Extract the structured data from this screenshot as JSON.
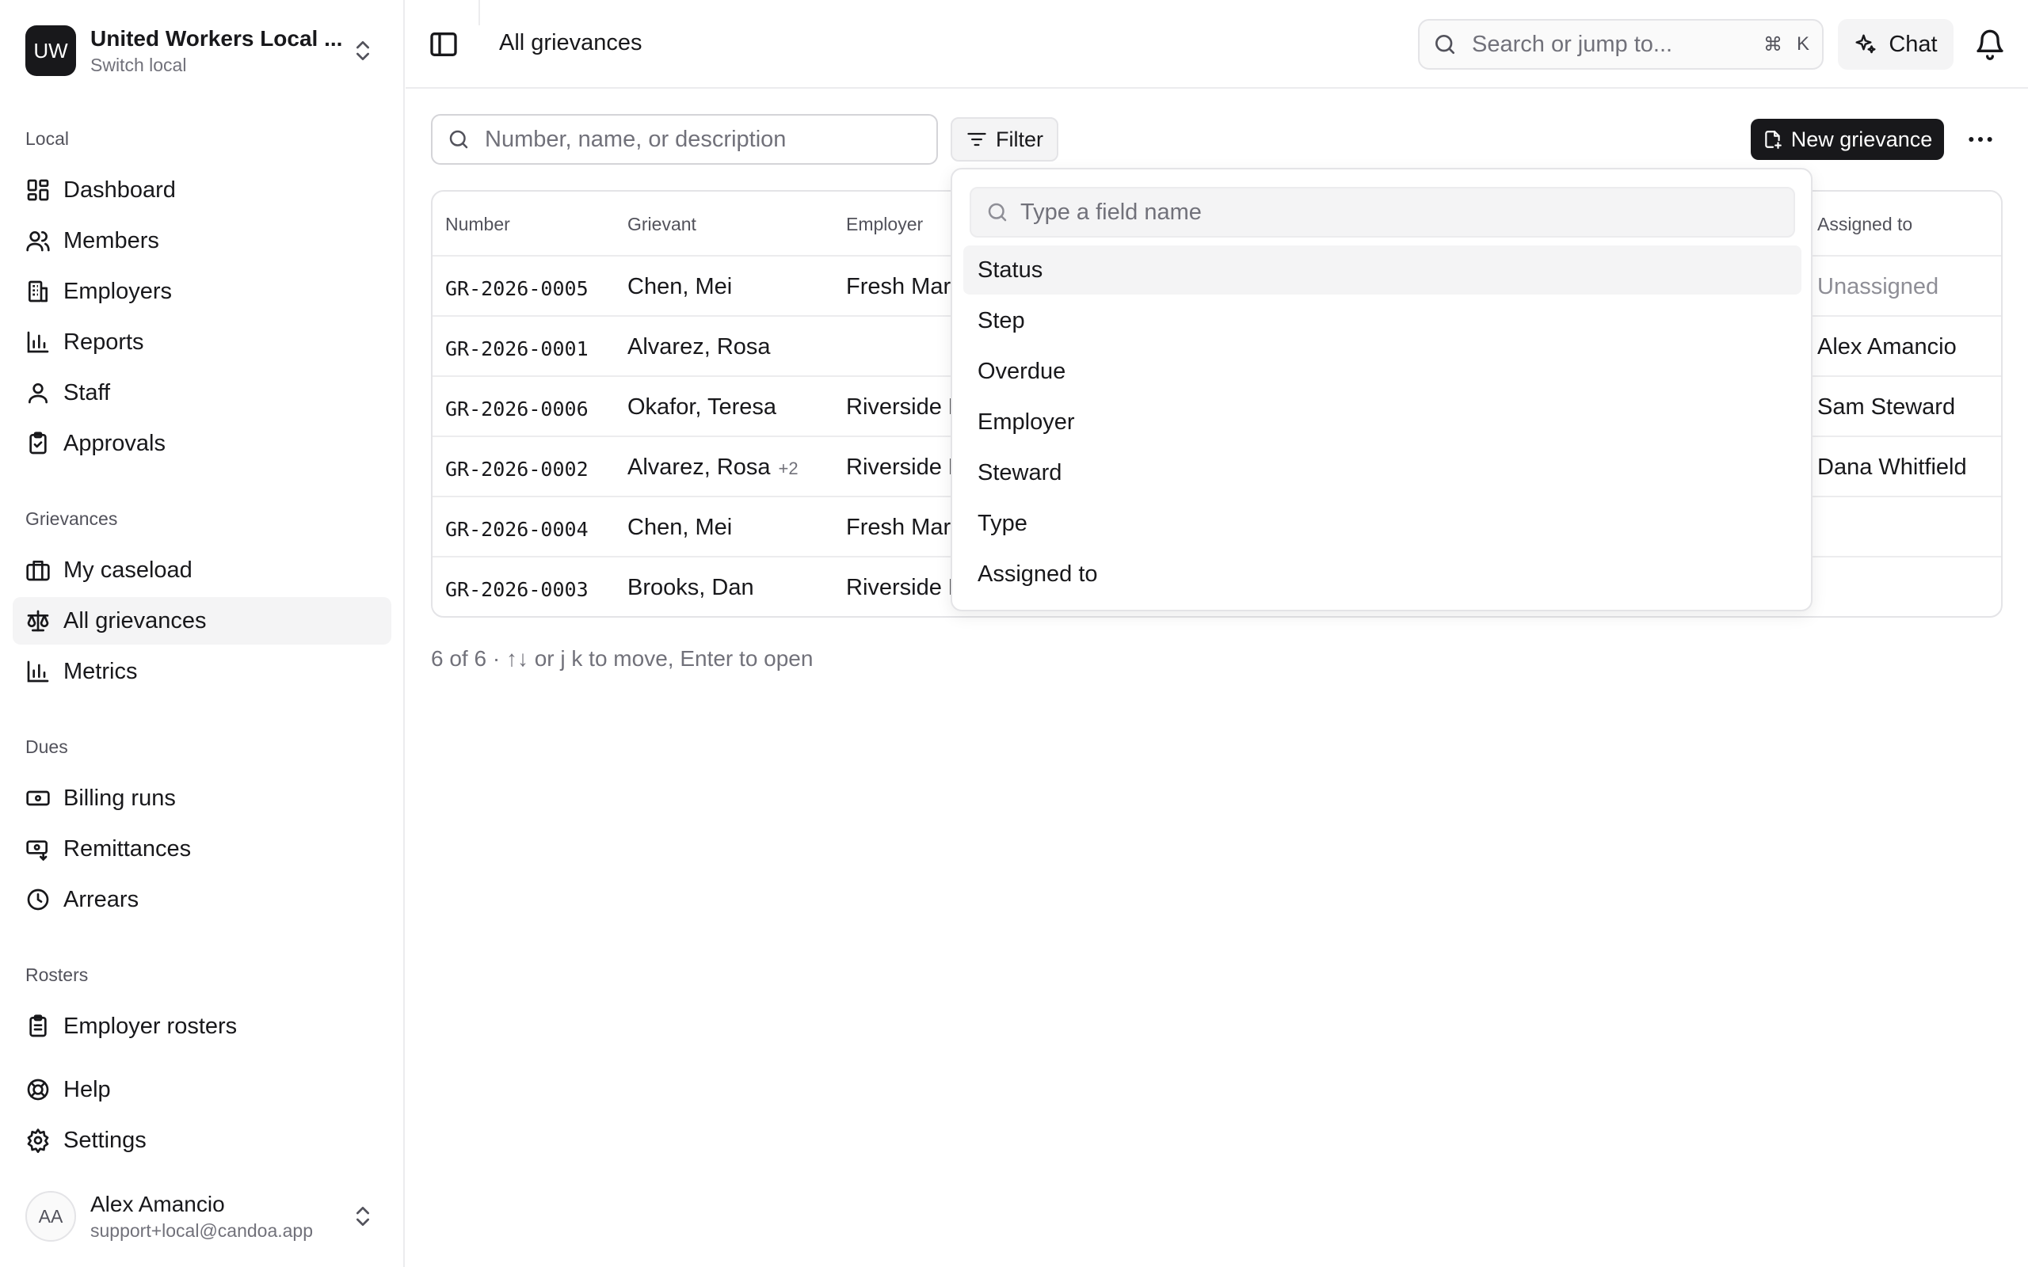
{
  "org": {
    "initials": "UW",
    "name": "United Workers Local ...",
    "subtitle": "Switch local"
  },
  "sections": {
    "local": "Local",
    "grievances": "Grievances",
    "dues": "Dues",
    "rosters": "Rosters"
  },
  "nav": {
    "dashboard": "Dashboard",
    "members": "Members",
    "employers": "Employers",
    "reports": "Reports",
    "staff": "Staff",
    "approvals": "Approvals",
    "my_caseload": "My caseload",
    "all_grievances": "All grievances",
    "metrics": "Metrics",
    "billing_runs": "Billing runs",
    "remittances": "Remittances",
    "arrears": "Arrears",
    "employer_rosters": "Employer rosters",
    "help": "Help",
    "settings": "Settings"
  },
  "user": {
    "initials": "AA",
    "name": "Alex Amancio",
    "email": "support+local@candoa.app"
  },
  "header": {
    "title": "All grievances",
    "search_placeholder": "Search or jump to...",
    "shortcut_cmd": "⌘",
    "shortcut_key": "K",
    "chat_label": "Chat"
  },
  "toolbar": {
    "search_placeholder": "Number, name, or description",
    "filter_label": "Filter",
    "new_label": "New grievance"
  },
  "table": {
    "columns": {
      "number": "Number",
      "grievant": "Grievant",
      "employer": "Employer",
      "assigned": "Assigned to"
    },
    "rows": [
      {
        "number": "GR-2026-0005",
        "grievant": "Chen, Mei",
        "extra": "",
        "employer": "Fresh Mar",
        "assigned": "Unassigned"
      },
      {
        "number": "GR-2026-0001",
        "grievant": "Alvarez, Rosa",
        "extra": "",
        "employer": "",
        "assigned": "Alex Amancio"
      },
      {
        "number": "GR-2026-0006",
        "grievant": "Okafor, Teresa",
        "extra": "",
        "employer": "Riverside F",
        "assigned": "Sam Steward"
      },
      {
        "number": "GR-2026-0002",
        "grievant": "Alvarez, Rosa",
        "extra": "+2",
        "employer": "Riverside F",
        "assigned": "Dana Whitfield"
      },
      {
        "number": "GR-2026-0004",
        "grievant": "Chen, Mei",
        "extra": "",
        "employer": "Fresh Mar",
        "assigned": ""
      },
      {
        "number": "GR-2026-0003",
        "grievant": "Brooks, Dan",
        "extra": "",
        "employer": "Riverside F",
        "assigned": ""
      }
    ]
  },
  "footer_hint": "6 of 6 · ↑↓ or j k to move, Enter to open",
  "dropdown": {
    "search_placeholder": "Type a field name",
    "items": [
      "Status",
      "Step",
      "Overdue",
      "Employer",
      "Steward",
      "Type",
      "Assigned to"
    ]
  },
  "colors": {
    "primary": "#18181b",
    "muted": "#71717a",
    "border": "#e4e4e7",
    "highlight": "#f4f4f5"
  }
}
